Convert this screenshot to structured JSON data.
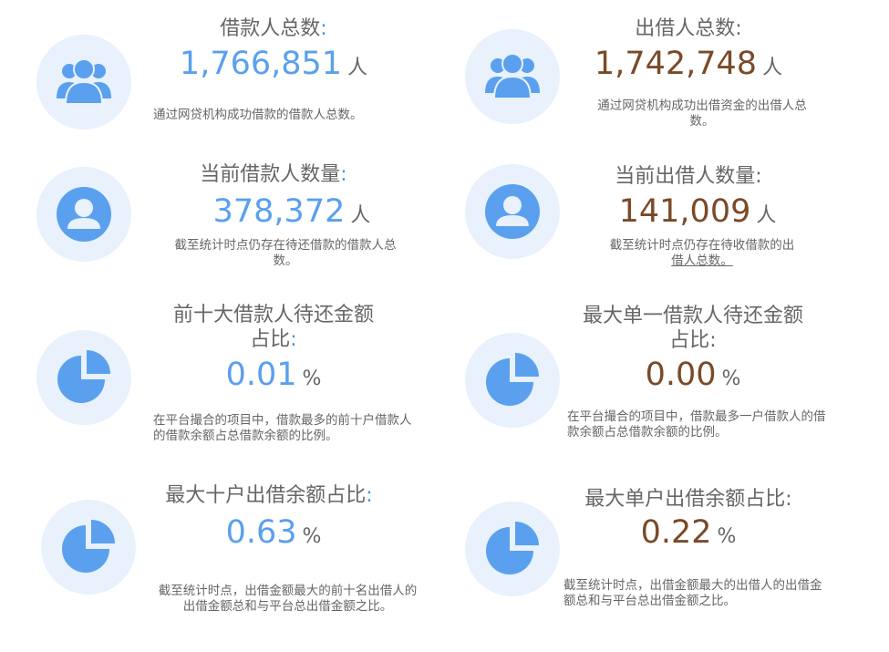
{
  "stats": [
    {
      "title": "借款人总数",
      "colon": ":",
      "value": "1,766,851",
      "unit": "人",
      "desc": "通过网贷机构成功借款的借款人总数。",
      "icon": "users-group-icon"
    },
    {
      "title": "出借人总数",
      "colon": ":",
      "value": "1,742,748",
      "unit": "人",
      "desc": "通过网贷机构成功出借资金的出借人总数。",
      "icon": "users-group-icon"
    },
    {
      "title": "当前借款人数量",
      "colon": ":",
      "value": "378,372",
      "unit": "人",
      "desc": "截至统计时点仍存在待还借款的借款人总数。",
      "icon": "user-icon"
    },
    {
      "title": "当前出借人数量",
      "colon": ":",
      "value": "141,009",
      "unit": "人",
      "desc_a": "截至统计时点仍存在待收借款的出",
      "desc_b": "借人总数。",
      "icon": "user-icon"
    },
    {
      "title_a": "前十大借款人待还金额",
      "title_b": "占比",
      "colon": ":",
      "value": "0.01",
      "unit": "%",
      "desc": "在平台撮合的项目中，借款最多的前十户借款人的借款余额占总借款余额的比例。",
      "icon": "pie-chart-icon"
    },
    {
      "title_a": "最大单一借款人待还金额",
      "title_b": "占比",
      "colon": ":",
      "value": "0.00",
      "unit": "%",
      "desc": "在平台撮合的项目中，借款最多一户借款人的借款余额占总借款余额的比例。",
      "icon": "pie-chart-icon"
    },
    {
      "title": "最大十户出借余额占比",
      "colon": ":",
      "value": "0.63",
      "unit": "%",
      "desc": "截至统计时点，出借金额最大的前十名出借人的出借金额总和与平台总出借金额之比。",
      "icon": "pie-chart-icon"
    },
    {
      "title": "最大单户出借余额占比",
      "colon": ":",
      "value": "0.22",
      "unit": "%",
      "desc": "截至统计时点，出借金额最大的出借人的出借金额总和与平台总出借金额之比。",
      "icon": "pie-chart-icon"
    }
  ],
  "colors": {
    "blue": "#5aa0ee",
    "brown": "#7a4a28",
    "icon_bg": "#e8f1fc",
    "icon": "#5aa0ee"
  }
}
